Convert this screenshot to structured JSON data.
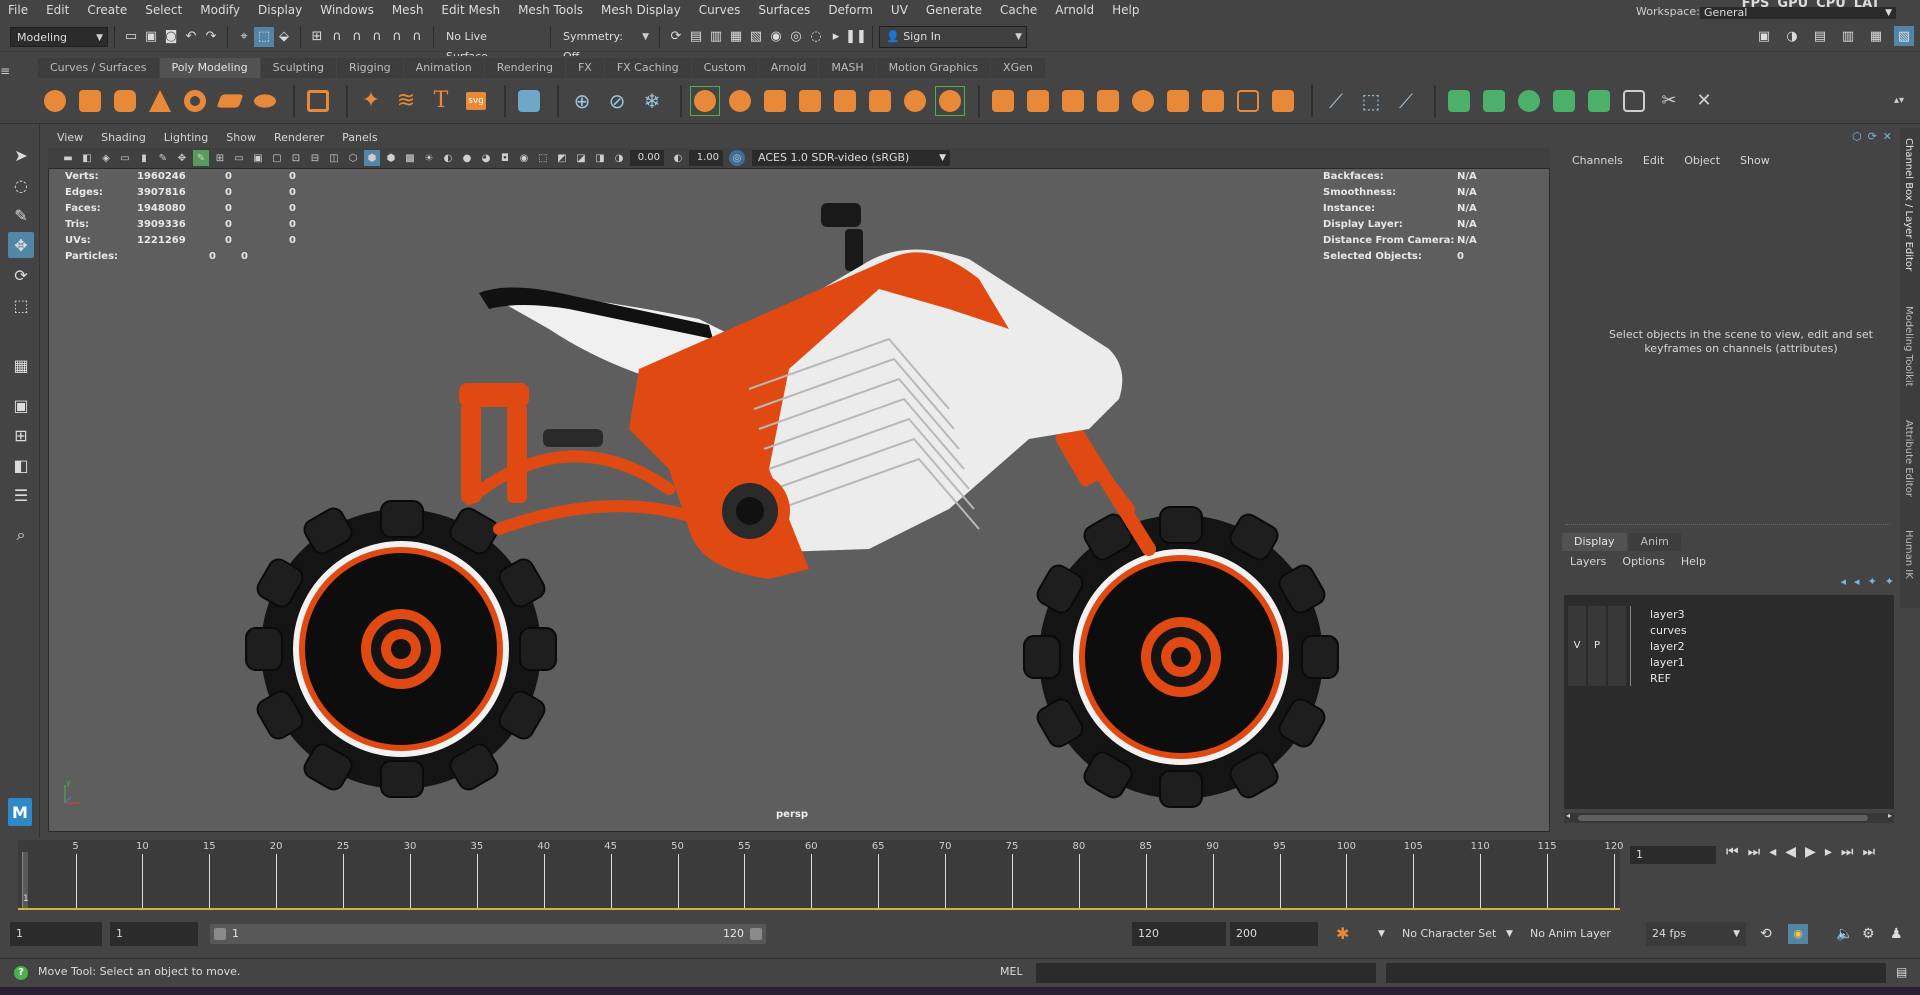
{
  "menubar": {
    "items": [
      "File",
      "Edit",
      "Create",
      "Select",
      "Modify",
      "Display",
      "Windows",
      "Mesh",
      "Edit Mesh",
      "Mesh Tools",
      "Mesh Display",
      "Curves",
      "Surfaces",
      "Deform",
      "UV",
      "Generate",
      "Cache",
      "Arnold",
      "Help"
    ],
    "perf": [
      "FPS",
      "GPU",
      "CPU",
      "LAT"
    ],
    "workspace_label": "Workspace:",
    "workspace_value": "General"
  },
  "statusline": {
    "menu_set": "Modeling",
    "live_surface": "No Live Surface",
    "symmetry": "Symmetry: Off",
    "sign_in": "Sign In"
  },
  "shelf": {
    "tabs": [
      "Curves / Surfaces",
      "Poly Modeling",
      "Sculpting",
      "Rigging",
      "Animation",
      "Rendering",
      "FX",
      "FX Caching",
      "Custom",
      "Arnold",
      "MASH",
      "Motion Graphics",
      "XGen"
    ],
    "active_tab": "Poly Modeling"
  },
  "viewport": {
    "menu": [
      "View",
      "Shading",
      "Lighting",
      "Show",
      "Renderer",
      "Panels"
    ],
    "exposure": "0.00",
    "gamma": "1.00",
    "colorspace": "ACES 1.0 SDR-video (sRGB)",
    "camera": "persp",
    "hud_left": [
      {
        "label": "Verts:",
        "v1": "1960246",
        "v2": "0",
        "v3": "0"
      },
      {
        "label": "Edges:",
        "v1": "3907816",
        "v2": "0",
        "v3": "0"
      },
      {
        "label": "Faces:",
        "v1": "1948080",
        "v2": "0",
        "v3": "0"
      },
      {
        "label": "Tris:",
        "v1": "3909336",
        "v2": "0",
        "v3": "0"
      },
      {
        "label": "UVs:",
        "v1": "1221269",
        "v2": "0",
        "v3": "0"
      },
      {
        "label": "Particles:",
        "v1": "",
        "v2": "0",
        "v3": "0"
      }
    ],
    "hud_right": [
      {
        "label": "Backfaces:",
        "value": "N/A"
      },
      {
        "label": "Smoothness:",
        "value": "N/A"
      },
      {
        "label": "Instance:",
        "value": "N/A"
      },
      {
        "label": "Display Layer:",
        "value": "N/A"
      },
      {
        "label": "Distance From Camera:",
        "value": "N/A"
      },
      {
        "label": "Selected Objects:",
        "value": "0"
      }
    ],
    "axis_label": "y"
  },
  "channel_box": {
    "menu": [
      "Channels",
      "Edit",
      "Object",
      "Show"
    ],
    "empty_message_line1": "Select objects in the scene to view, edit and set",
    "empty_message_line2": "keyframes on channels (attributes)"
  },
  "side_tabs": [
    "Channel Box / Layer Editor",
    "Modeling Toolkit",
    "Attribute Editor",
    "Human IK"
  ],
  "layer_editor": {
    "tabs": [
      "Display",
      "Anim"
    ],
    "active_tab": "Display",
    "menu": [
      "Layers",
      "Options",
      "Help"
    ],
    "layers": [
      {
        "name": "layer3",
        "v": "",
        "p": ""
      },
      {
        "name": "curves",
        "v": "",
        "p": ""
      },
      {
        "name": "layer2",
        "v": "V",
        "p": "P"
      },
      {
        "name": "layer1",
        "v": "",
        "p": ""
      },
      {
        "name": "REF",
        "v": "",
        "p": ""
      }
    ]
  },
  "timeline": {
    "ticks": [
      "5",
      "10",
      "15",
      "20",
      "25",
      "30",
      "35",
      "40",
      "45",
      "50",
      "55",
      "60",
      "65",
      "70",
      "75",
      "80",
      "85",
      "90",
      "95",
      "100",
      "105",
      "110",
      "115",
      "120"
    ],
    "current_frame_marker": "1",
    "current_frame": "1"
  },
  "range": {
    "start": "1",
    "playback_start": "1",
    "slider_start": "1",
    "slider_end": "120",
    "playback_end": "120",
    "end": "200",
    "character_set": "No Character Set",
    "anim_layer": "No Anim Layer",
    "fps": "24 fps"
  },
  "helpline": {
    "text": "Move Tool: Select an object to move.",
    "mel": "MEL"
  }
}
